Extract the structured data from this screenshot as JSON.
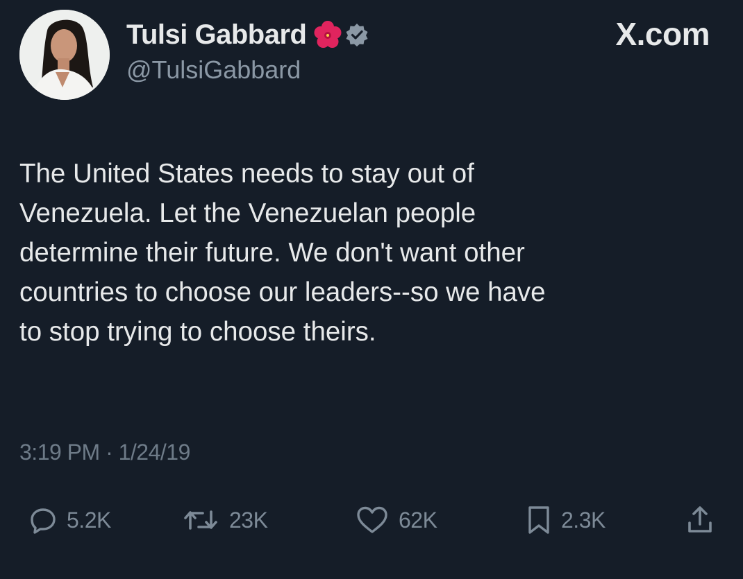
{
  "source": {
    "label": "X.com"
  },
  "author": {
    "display_name": "Tulsi Gabbard",
    "handle": "@TulsiGabbard",
    "badge_emoji_icon": "hibiscus-icon",
    "verified_icon": "verified-badge-icon"
  },
  "tweet": {
    "text": "The United States needs to stay out of\nVenezuela. Let the Venezuelan people\ndetermine their future. We don't want other\ncountries to choose our leaders--so we have\nto stop trying to choose theirs.",
    "timestamp": "3:19 PM · 1/24/19"
  },
  "actions": {
    "reply": {
      "icon": "reply-icon",
      "count": "5.2K"
    },
    "repost": {
      "icon": "repost-icon",
      "count": "23K"
    },
    "like": {
      "icon": "heart-icon",
      "count": "62K"
    },
    "bookmark": {
      "icon": "bookmark-icon",
      "count": "2.3K"
    },
    "share": {
      "icon": "share-icon"
    }
  },
  "colors": {
    "background": "#151d28",
    "primary_text": "#e7e9ea",
    "secondary_text": "#8b98a5",
    "action_gray": "#7d8a97",
    "hibiscus_red": "#e0245e"
  }
}
